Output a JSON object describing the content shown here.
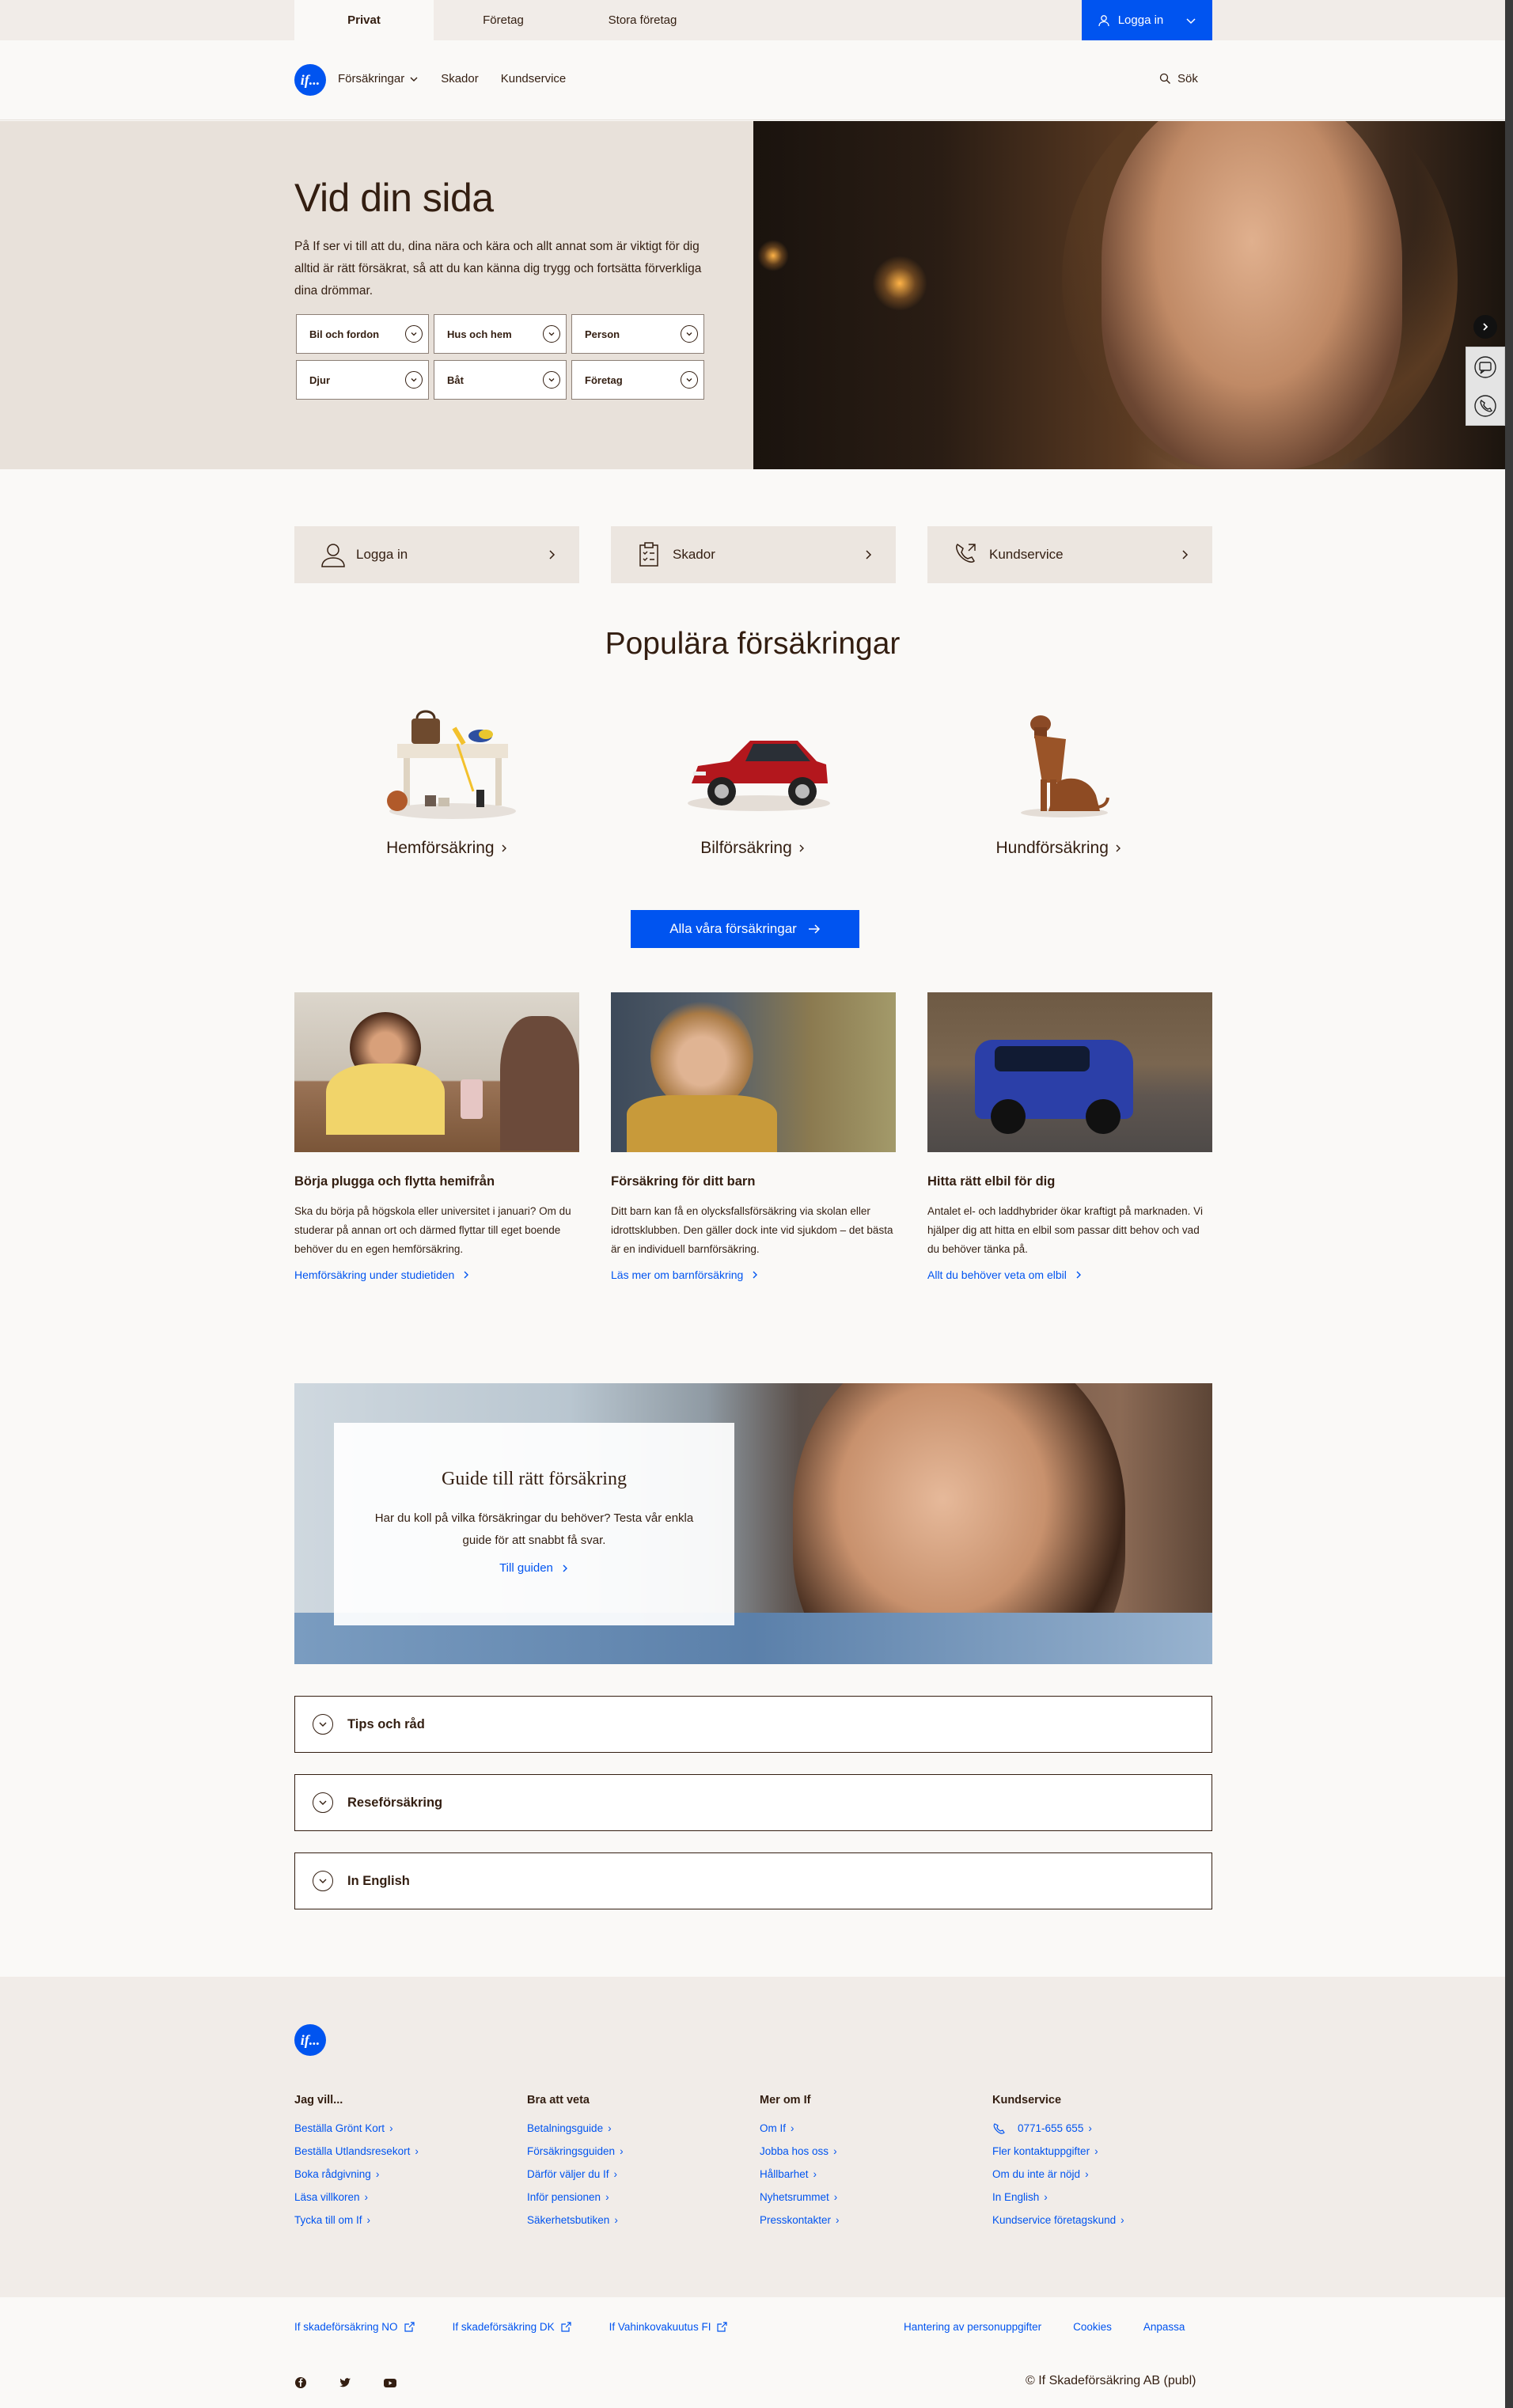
{
  "top_tabs": [
    "Privat",
    "Företag",
    "Stora företag"
  ],
  "top_login": "Logga in",
  "logo_text": "if...",
  "nav": {
    "insurances": "Försäkringar",
    "claims": "Skador",
    "service": "Kundservice",
    "search": "Sök"
  },
  "hero": {
    "title": "Vid din sida",
    "text": "På If ser vi till att du, dina nära och kära och allt annat som är viktigt för dig alltid är rätt försäkrat, så att du kan känna dig trygg och fortsätta förverkliga dina drömmar.",
    "chips": [
      "Bil och fordon",
      "Hus och hem",
      "Person",
      "Djur",
      "Båt",
      "Företag"
    ]
  },
  "quick_links": [
    {
      "label": "Logga in",
      "icon": "user-icon"
    },
    {
      "label": "Skador",
      "icon": "clipboard-icon"
    },
    {
      "label": "Kundservice",
      "icon": "phone-icon"
    }
  ],
  "popular": {
    "title": "Populära försäkringar",
    "items": [
      "Hemförsäkring",
      "Bilförsäkring",
      "Hundförsäkring"
    ],
    "button": "Alla våra försäkringar"
  },
  "articles": [
    {
      "title": "Börja plugga och flytta hemifrån",
      "text": "Ska du börja på högskola eller universitet i januari? Om du studerar på annan ort och därmed flyttar till eget boende behöver du en egen hemförsäkring.",
      "link": "Hemförsäkring under studietiden"
    },
    {
      "title": "Försäkring för ditt barn",
      "text": "Ditt barn kan få en olycksfallsförsäkring via skolan eller idrottsklubben. Den gäller dock inte vid sjukdom – det bästa är en individuell barnförsäkring.",
      "link": "Läs mer om barnförsäkring"
    },
    {
      "title": "Hitta rätt elbil för dig",
      "text": "Antalet el- och laddhybrider ökar kraftigt på marknaden. Vi hjälper dig att hitta en elbil som passar ditt behov och vad du behöver tänka på.",
      "link": "Allt du behöver veta om elbil"
    }
  ],
  "guide": {
    "title": "Guide till rätt försäkring",
    "text": "Har du koll på vilka försäkringar du behöver? Testa vår enkla guide för att snabbt få svar.",
    "link": "Till guiden"
  },
  "accordion": [
    "Tips och råd",
    "Reseförsäkring",
    "In English"
  ],
  "footer": {
    "columns": [
      {
        "title": "Jag vill...",
        "links": [
          "Beställa Grönt Kort",
          "Beställa Utlandsresekort",
          "Boka rådgivning",
          "Läsa villkoren",
          "Tycka till om If"
        ]
      },
      {
        "title": "Bra att veta",
        "links": [
          "Betalningsguide",
          "Försäkringsguiden",
          "Därför väljer du If",
          "Inför pensionen",
          "Säkerhetsbutiken"
        ]
      },
      {
        "title": "Mer om If",
        "links": [
          "Om If",
          "Jobba hos oss",
          "Hållbarhet",
          "Nyhetsrummet",
          "Presskontakter"
        ]
      },
      {
        "title": "Kundservice",
        "links": [
          "0771-655 655",
          "Fler kontaktuppgifter",
          "Om du inte är nöjd",
          "In English",
          "Kundservice företagskund"
        ]
      }
    ],
    "external": [
      "If skadeförsäkring NO",
      "If skadeförsäkring DK",
      "If Vahinkovakuutus FI"
    ],
    "legal": [
      "Hantering av personuppgifter",
      "Cookies",
      "Anpassa"
    ],
    "social": [
      "facebook-icon",
      "twitter-icon",
      "youtube-icon"
    ],
    "copyright": "© If Skadeförsäkring AB (publ)"
  },
  "colors": {
    "brand_blue": "#0054f0",
    "beige": "#e8e1da",
    "text": "#331e11",
    "background": "#faf9f7"
  }
}
